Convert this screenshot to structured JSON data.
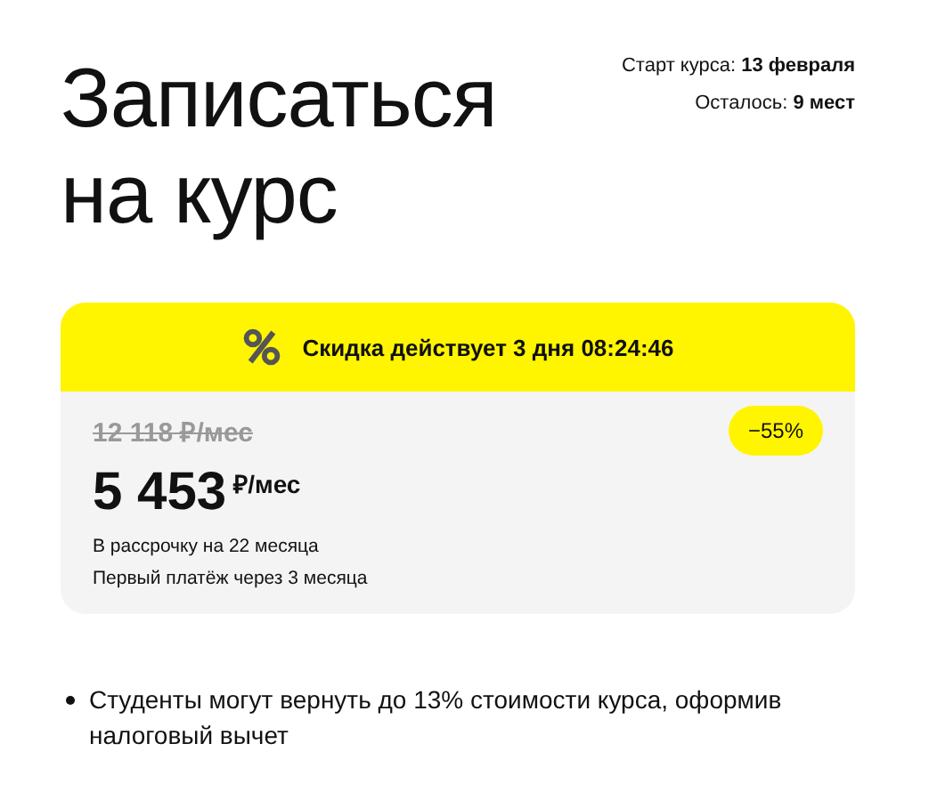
{
  "title": [
    "Записаться",
    "на курс"
  ],
  "info": [
    "Старт курса: **13 февраля**",
    "Осталось: **9 мест**"
  ],
  "offer": {
    "banner": "Скидка действует 3 дня 08:24:46",
    "old_price": "12 118 ₽/мес",
    "discount": "−55%",
    "price": "5 453",
    "price_unit": "₽/мес",
    "notes": [
      "В рассрочку на 22 месяца",
      "Первый платёж через 3 месяца"
    ]
  },
  "bullets": [
    "Студенты могут вернуть до 13% стоимости курса, оформив налоговый вычет"
  ]
}
